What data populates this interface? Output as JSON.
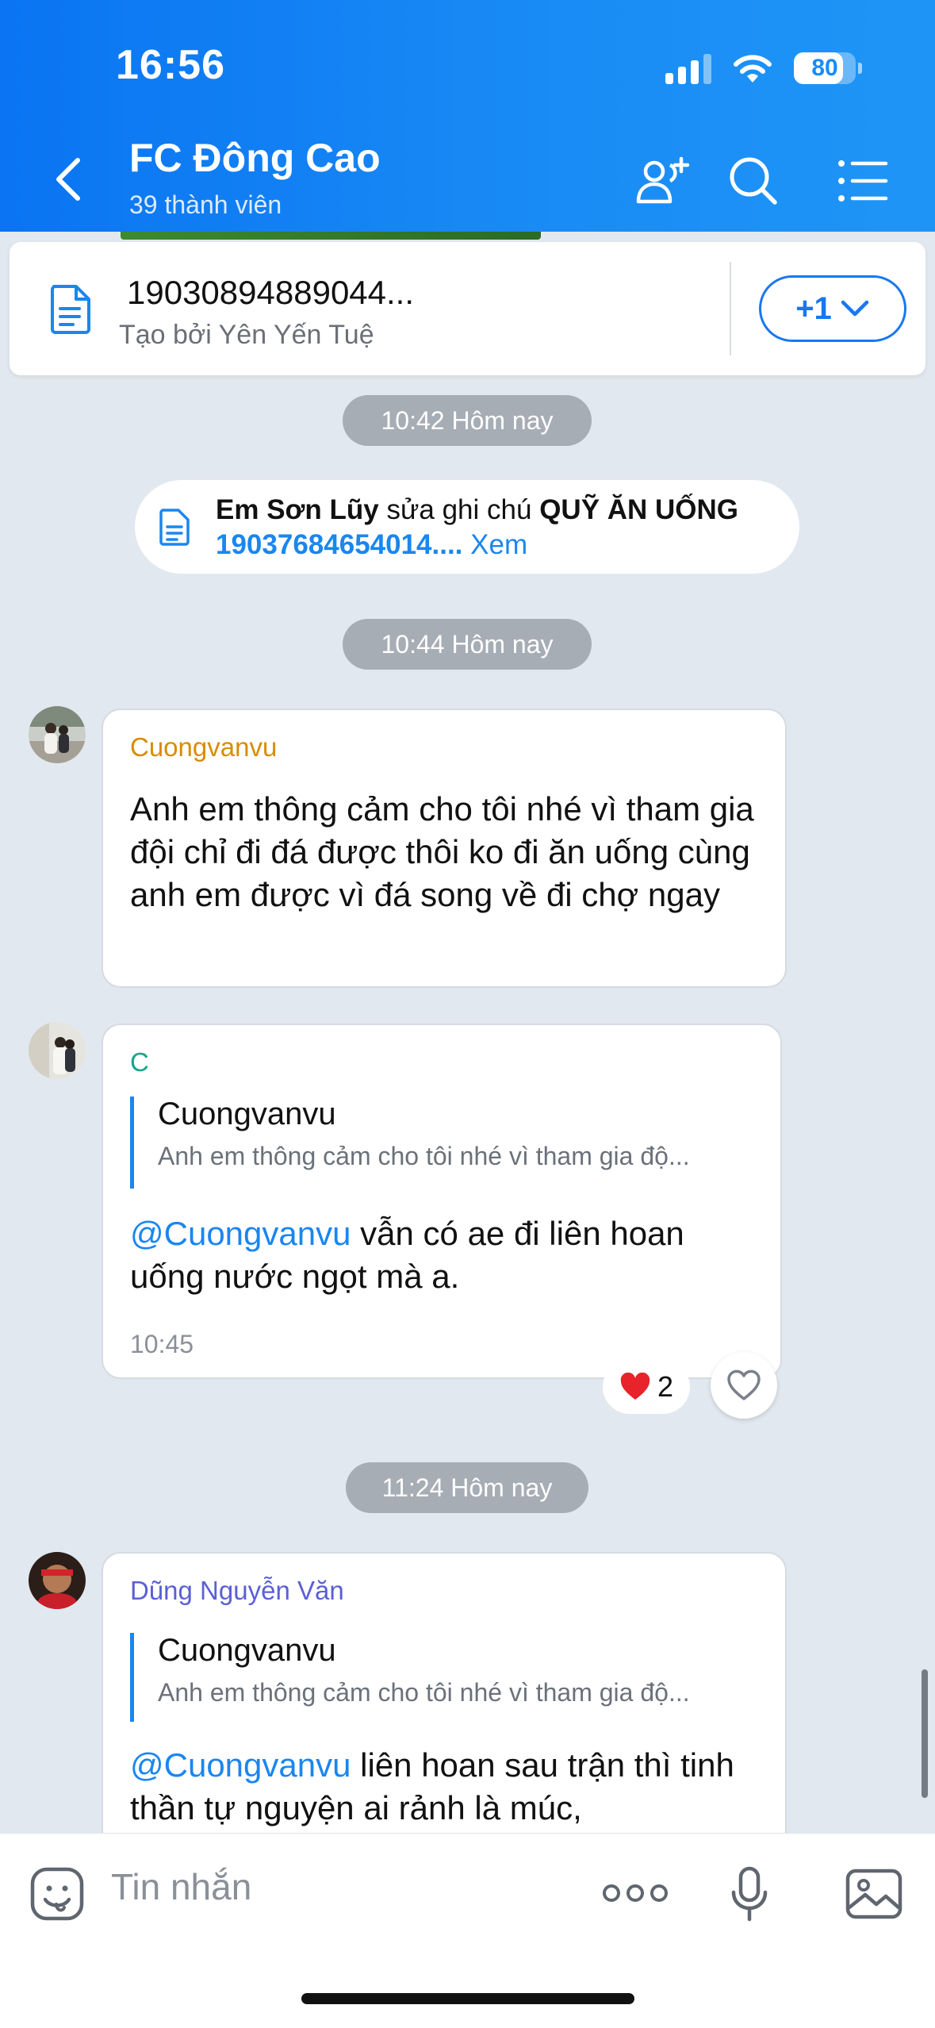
{
  "status_bar": {
    "time": "16:56",
    "battery": "80",
    "battery_level": 0.8
  },
  "header": {
    "title": "FC Đông Cao",
    "subtitle": "39 thành viên",
    "icons": [
      "back-icon",
      "add-member-icon",
      "search-icon",
      "menu-list-icon"
    ]
  },
  "pinned_note": {
    "title": "19030894889044...",
    "created_by": "Tạo bởi Yên Yến Tuệ",
    "more_label": "+1"
  },
  "timestamps": [
    "10:42 Hôm nay",
    "10:44 Hôm nay",
    "11:24 Hôm nay"
  ],
  "system_note": {
    "actor": "Em Sơn Lũy",
    "action": " sửa ghi chú ",
    "note_name": "QUỸ ĂN UỐNG",
    "note_id": "19037684654014....",
    "view_label": " Xem"
  },
  "messages": [
    {
      "sender": "Cuongvanvu",
      "sender_color": "#d98c00",
      "text": "Anh em thông cảm cho tôi nhé vì tham gia đội chỉ đi đá được thôi ko đi ăn uống cùng anh em được vì đá song về đi chợ ngay"
    },
    {
      "sender": "C",
      "sender_color": "#17a589",
      "quote_name": "Cuongvanvu",
      "quote_text": "Anh em thông cảm cho tôi nhé vì tham gia độ...",
      "mention": "@Cuongvanvu",
      "text": " vẫn có ae đi liên hoan uống nước ngọt mà a.",
      "time": "10:45",
      "reaction_count": "2"
    },
    {
      "sender": "Dũng Nguyễn Văn",
      "sender_color": "#5b5fd6",
      "quote_name": "Cuongvanvu",
      "quote_text": "Anh em thông cảm cho tôi nhé vì tham gia độ...",
      "mention": "@Cuongvanvu",
      "text": " liên hoan sau trận thì tinh thần tự nguyện ai rảnh là múc,"
    }
  ],
  "composer": {
    "placeholder": "Tin nhắn"
  }
}
